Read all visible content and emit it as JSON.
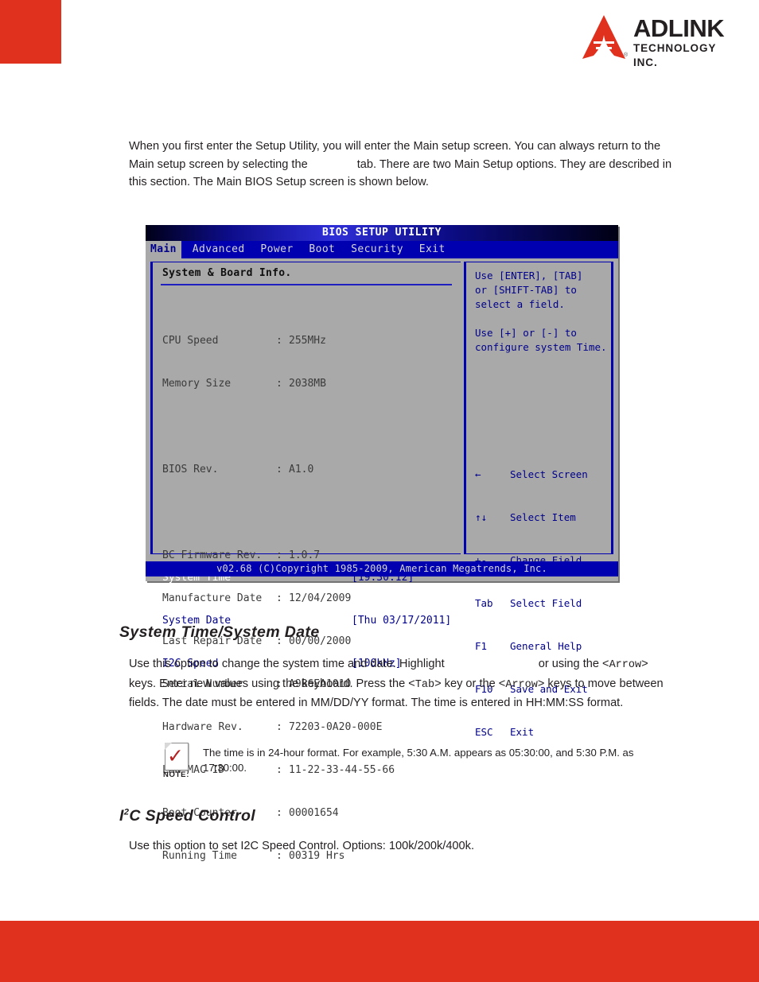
{
  "brand": {
    "name": "ADLINK",
    "tagline": "TECHNOLOGY INC.",
    "registered": "®",
    "accent_color": "#e0301e"
  },
  "intro": {
    "part1": "When you first enter the Setup Utility, you will enter the Main setup screen. You can always return to the Main setup screen by selecting the",
    "part2": "tab. There are two Main Setup options. They are described in this section. The Main BIOS Setup screen is shown below."
  },
  "bios": {
    "title": "BIOS SETUP UTILITY",
    "menu": [
      {
        "label": "Main",
        "active": true
      },
      {
        "label": "Advanced",
        "active": false
      },
      {
        "label": "Power",
        "active": false
      },
      {
        "label": "Boot",
        "active": false
      },
      {
        "label": "Security",
        "active": false
      },
      {
        "label": "Exit",
        "active": false
      }
    ],
    "pane_heading": "System & Board Info.",
    "info": [
      {
        "key": "CPU Speed",
        "value": "255MHz"
      },
      {
        "key": "Memory Size",
        "value": "2038MB"
      },
      {
        "key": "BIOS Rev.",
        "value": "A1.0"
      },
      {
        "key": "BC Firmware Rev.",
        "value": "1.0.7"
      },
      {
        "key": "Manufacture Date",
        "value": "12/04/2009"
      },
      {
        "key": "Last Repair Date",
        "value": "00/00/2000"
      },
      {
        "key": "Serial Number",
        "value": "A9B6EA1010"
      },
      {
        "key": "Hardware Rev.",
        "value": "72203-0A20-000E"
      },
      {
        "key": "LAN MAC ID",
        "value": "11-22-33-44-55-66"
      },
      {
        "key": "Boot Counter",
        "value": "00001654"
      },
      {
        "key": "Running Time",
        "value": "00319 Hrs"
      }
    ],
    "settings": [
      {
        "label": "System Time",
        "value": "[19:30:12]",
        "selected": true
      },
      {
        "label": "System Date",
        "value": "[Thu 03/17/2011]",
        "selected": false
      },
      {
        "label": "I2C Speed",
        "value": "[100kHz]",
        "selected": false
      }
    ],
    "help": "Use [ENTER], [TAB]\nor [SHIFT-TAB] to\nselect a field.\n\nUse [+] or [-] to\nconfigure system Time.",
    "keys": [
      {
        "key": "←",
        "action": "Select Screen"
      },
      {
        "key": "↑↓",
        "action": "Select Item"
      },
      {
        "key": "+-",
        "action": "Change Field"
      },
      {
        "key": "Tab",
        "action": "Select Field"
      },
      {
        "key": "F1",
        "action": "General Help"
      },
      {
        "key": "F10",
        "action": "Save and Exit"
      },
      {
        "key": "ESC",
        "action": "Exit"
      }
    ],
    "footer": "v02.68 (C)Copyright 1985-2009, American Megatrends, Inc."
  },
  "sections": {
    "time_date": {
      "heading": "System Time/System Date",
      "body_a": "Use this option to change the system time and date. Highlight",
      "body_b": "or",
      "body_c": "using the <",
      "key_arrow_1": "Arrow",
      "body_d": "> keys. Enter new values using the keyboard. Press the <",
      "key_tab": "Tab",
      "body_e": "> key or the <",
      "key_arrow_2": "Arrow",
      "body_f": "> keys to move between fields. The date must be entered in MM/DD/YY format. The time is entered in HH:MM:SS format."
    },
    "note": {
      "label": "NOTE:",
      "text": "The time is in 24-hour format. For example, 5:30 A.M. appears as 05:30:00, and 5:30 P.M. as 17:30:00."
    },
    "i2c": {
      "heading_pre": "I",
      "heading_sup": "2",
      "heading_post": "C Speed Control",
      "body": "Use this option to set I2C Speed Control. Options: 100k/200k/400k."
    }
  }
}
